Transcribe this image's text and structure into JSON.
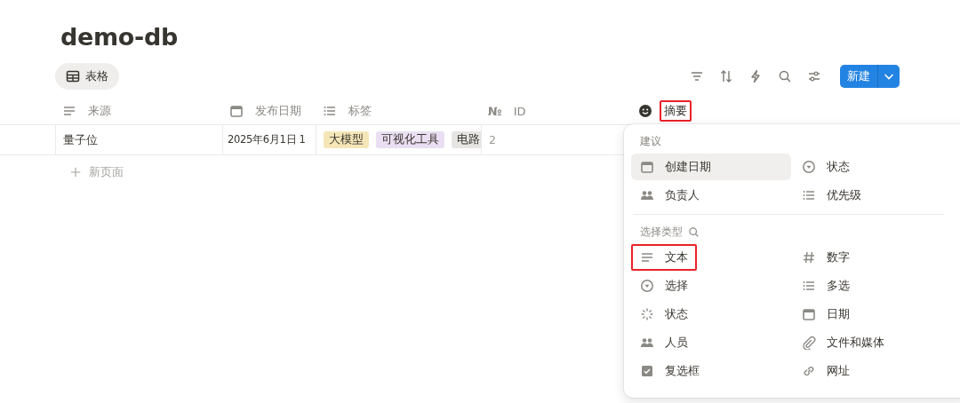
{
  "title": "demo-db",
  "views": [
    {
      "label": "表格",
      "selected": true
    }
  ],
  "toolbar": {
    "new_button": "新建"
  },
  "table": {
    "columns": [
      {
        "label": "来源",
        "highlighted": false
      },
      {
        "label": "发布日期",
        "highlighted": false
      },
      {
        "label": "标签",
        "highlighted": false
      },
      {
        "symbol": "№",
        "label": "ID",
        "highlighted": false
      },
      {
        "label": "摘要",
        "highlighted": true
      }
    ],
    "rows": [
      {
        "来源": "量子位",
        "发布日期": "2025年6月1日 1",
        "标签": [
          {
            "label": "大模型",
            "color": "#f5e6b8"
          },
          {
            "label": "可视化工具",
            "color": "#eadff2"
          },
          {
            "label": "电路",
            "color": "#e6e5e3"
          }
        ],
        "ID": "2"
      }
    ],
    "new_row": "新页面"
  },
  "menu": {
    "suggestions_label": "建议",
    "suggestions": [
      {
        "label": "创建日期",
        "selected": true
      },
      {
        "label": "状态",
        "selected": false
      },
      {
        "label": "负责人",
        "selected": false
      },
      {
        "label": "优先级",
        "selected": false
      }
    ],
    "types_label": "选择类型",
    "types": [
      {
        "label": "文本",
        "highlighted": true
      },
      {
        "label": "数字",
        "highlighted": false
      },
      {
        "label": "选择",
        "highlighted": false
      },
      {
        "label": "多选",
        "highlighted": false
      },
      {
        "label": "状态",
        "highlighted": false
      },
      {
        "label": "日期",
        "highlighted": false
      },
      {
        "label": "人员",
        "highlighted": false
      },
      {
        "label": "文件和媒体",
        "highlighted": false
      },
      {
        "label": "复选框",
        "highlighted": false
      },
      {
        "label": "网址",
        "highlighted": false
      }
    ]
  }
}
